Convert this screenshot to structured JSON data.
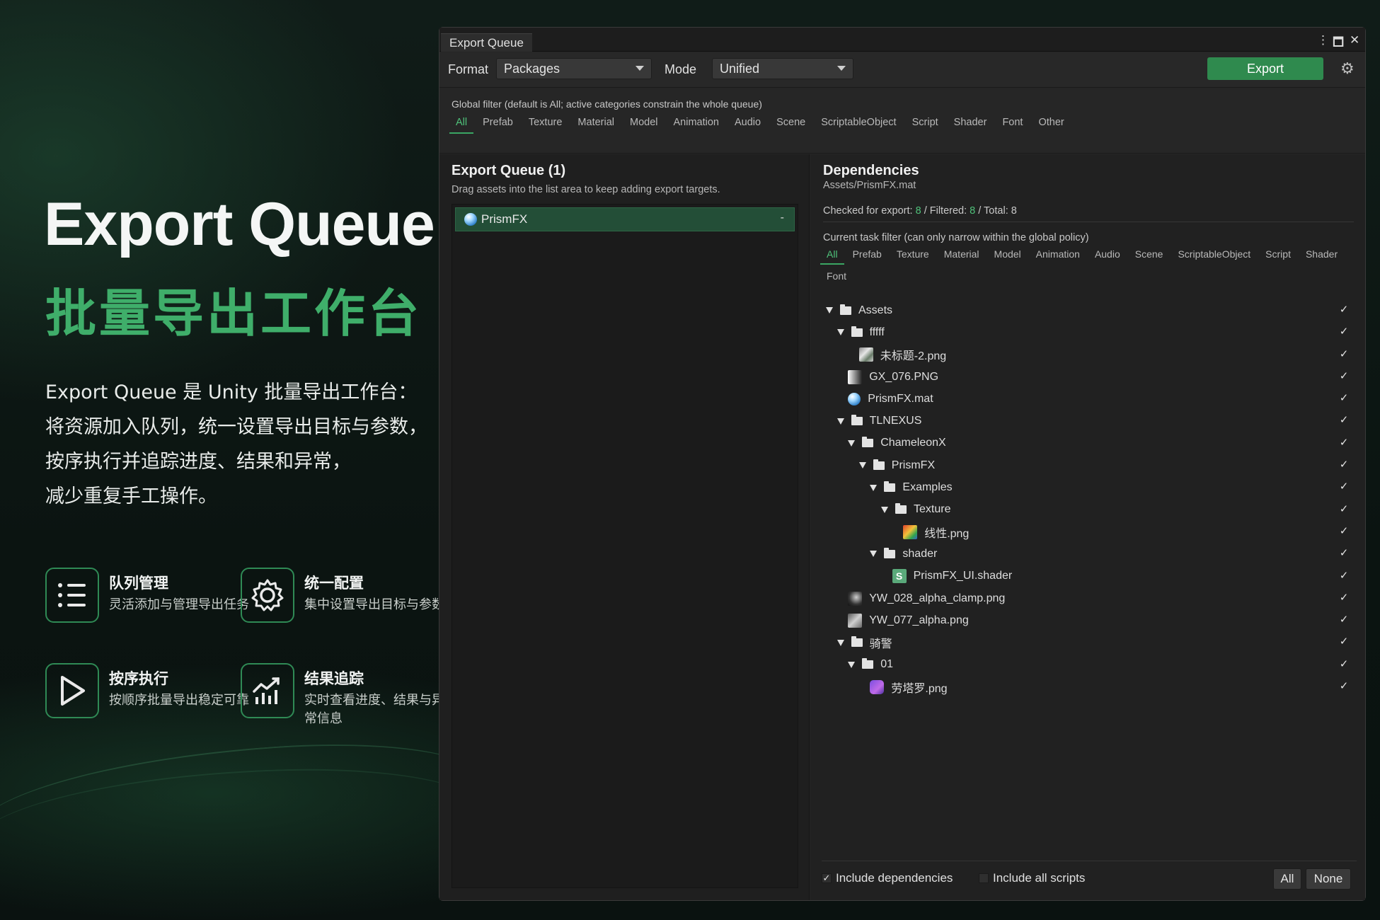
{
  "hero": {
    "title": "Export Queue",
    "subtitle": "批量导出工作台",
    "description": [
      "Export Queue 是 Unity 批量导出工作台：",
      "将资源加入队列，统一设置导出目标与参数，",
      "按序执行并追踪进度、结果和异常，",
      "减少重复手工操作。"
    ],
    "features": [
      {
        "icon": "list-icon",
        "title": "队列管理",
        "desc": "灵活添加与管理导出任务"
      },
      {
        "icon": "gear-icon",
        "title": "统一配置",
        "desc": "集中设置导出目标与参数"
      },
      {
        "icon": "play-icon",
        "title": "按序执行",
        "desc": "按顺序批量导出稳定可靠"
      },
      {
        "icon": "chart-icon",
        "title": "结果追踪",
        "desc": "实时查看进度、结果与异常信息"
      }
    ]
  },
  "window": {
    "tab_title": "Export Queue",
    "controls": {
      "menu": "⋮",
      "maximize": "🗖",
      "close": "✕"
    }
  },
  "toolbar": {
    "format_label": "Format",
    "format_value": "Packages",
    "mode_label": "Mode",
    "mode_value": "Unified",
    "export_label": "Export"
  },
  "global_filter": {
    "caption": "Global filter (default is All; active categories constrain the whole queue)",
    "categories": [
      "All",
      "Prefab",
      "Texture",
      "Material",
      "Model",
      "Animation",
      "Audio",
      "Scene",
      "ScriptableObject",
      "Script",
      "Shader",
      "Font",
      "Other"
    ],
    "active": "All"
  },
  "queue": {
    "title": "Export Queue (1)",
    "subtitle": "Drag assets into the list area to keep adding export targets.",
    "items": [
      {
        "name": "PrismFX",
        "remove": "-"
      }
    ]
  },
  "dependencies": {
    "title": "Dependencies",
    "path": "Assets/PrismFX.mat",
    "checked_label": "Checked for export:",
    "checked": "8",
    "filtered_label": "/ Filtered:",
    "filtered": "8",
    "total_label": "/ Total: 8",
    "task_filter_caption": "Current task filter (can only narrow within the global policy)",
    "task_categories": [
      "All",
      "Prefab",
      "Texture",
      "Material",
      "Model",
      "Animation",
      "Audio",
      "Scene",
      "ScriptableObject",
      "Script",
      "Shader",
      "Font"
    ],
    "tree": [
      {
        "label": "Assets",
        "kind": "folder",
        "depth": 0,
        "checked": true
      },
      {
        "label": "fffff",
        "kind": "folder",
        "depth": 1,
        "checked": true
      },
      {
        "label": "未标题-2.png",
        "kind": "image",
        "depth": 3,
        "checked": true
      },
      {
        "label": "GX_076.PNG",
        "kind": "gradient",
        "depth": 2,
        "checked": true
      },
      {
        "label": "PrismFX.mat",
        "kind": "material",
        "depth": 2,
        "checked": true
      },
      {
        "label": "TLNEXUS",
        "kind": "folder",
        "depth": 1,
        "checked": true
      },
      {
        "label": "ChameleonX",
        "kind": "folder",
        "depth": 2,
        "checked": true
      },
      {
        "label": "PrismFX",
        "kind": "folder",
        "depth": 3,
        "checked": true
      },
      {
        "label": "Examples",
        "kind": "folder",
        "depth": 4,
        "checked": true
      },
      {
        "label": "Texture",
        "kind": "folder",
        "depth": 5,
        "checked": true
      },
      {
        "label": "线性.png",
        "kind": "colorful",
        "depth": 7,
        "checked": true
      },
      {
        "label": "shader",
        "kind": "folder",
        "depth": 4,
        "checked": true
      },
      {
        "label": "PrismFX_UI.shader",
        "kind": "shader",
        "depth": 6,
        "checked": true
      },
      {
        "label": "YW_028_alpha_clamp.png",
        "kind": "dark",
        "depth": 2,
        "checked": true
      },
      {
        "label": "YW_077_alpha.png",
        "kind": "grey",
        "depth": 2,
        "checked": true
      },
      {
        "label": "骑警",
        "kind": "folder",
        "depth": 1,
        "checked": true
      },
      {
        "label": "01",
        "kind": "folder",
        "depth": 2,
        "checked": true
      },
      {
        "label": "劳塔罗.png",
        "kind": "purple",
        "depth": 4,
        "checked": true
      }
    ],
    "include_dependencies": "Include dependencies",
    "include_all_scripts": "Include all scripts",
    "all_label": "All",
    "none_label": "None"
  },
  "colors": {
    "accent": "#3fae6a",
    "export_button": "#2f8a4e",
    "queue_item": "#234e37"
  }
}
